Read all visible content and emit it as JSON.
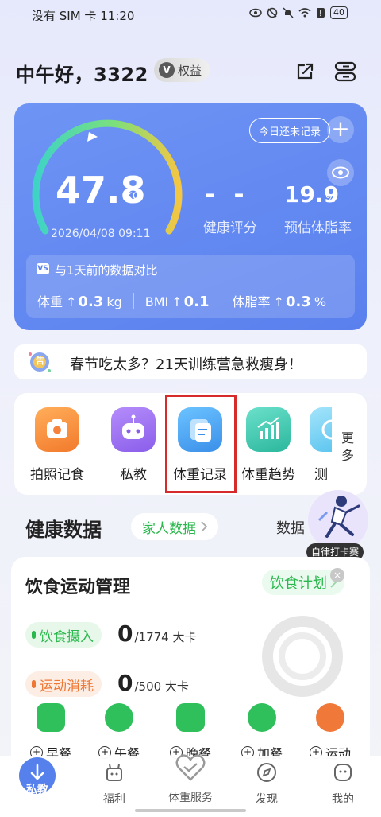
{
  "status_bar": {
    "left": "没有 SIM 卡 11:20",
    "battery": "40"
  },
  "header": {
    "greeting": "中午好，3322",
    "rights_label": "权益",
    "rights_mark": "V"
  },
  "weight_card": {
    "weight": "47.8",
    "unit": "kg",
    "date": "2026/04/08 09:11",
    "health_score": "- -",
    "health_label": "健康评分",
    "fat_value": "19.9",
    "fat_unit": "%",
    "fat_label": "预估体脂率",
    "record_button": "今日还未记录",
    "add_icon": "+",
    "compare": {
      "badge": "VS",
      "title": "与1天前的数据对比",
      "weight_label": "体重",
      "weight_arrow": "↑",
      "weight_value": "0.3",
      "weight_unit": "kg",
      "bmi_label": "BMI",
      "bmi_arrow": "↑",
      "bmi_value": "0.1",
      "fat_label": "体脂率",
      "fat_arrow": "↑",
      "fat_value": "0.3",
      "fat_unit": "%"
    }
  },
  "notice": {
    "icon_text": "告",
    "text": "春节吃太多？21天训练营急救瘦身！"
  },
  "quick_actions": [
    {
      "label": "拍照记食",
      "color": "#f5813a"
    },
    {
      "label": "私教",
      "color": "#9a6df0"
    },
    {
      "label": "体重记录",
      "color": "#4aa0f2"
    },
    {
      "label": "体重趋势",
      "color": "#3fc7b0"
    },
    {
      "label": "测",
      "color": "#66c9ef"
    }
  ],
  "more_label": "更多",
  "health_section": {
    "title": "健康数据",
    "family": "家人数据",
    "data_more": "数据"
  },
  "float_badge": {
    "label": "自律打卡赛"
  },
  "diet_card": {
    "title": "饮食运动管理",
    "plan": "饮食计划",
    "close_icon": "×",
    "intake_label": "饮食摄入",
    "intake_value": "0",
    "intake_total": "/1774 大卡",
    "burn_label": "运动消耗",
    "burn_value": "0",
    "burn_total": "/500 大卡",
    "meals": [
      {
        "label": "早餐",
        "color": "#2fbf5b"
      },
      {
        "label": "午餐",
        "color": "#2fbf5b"
      },
      {
        "label": "晚餐",
        "color": "#2fbf5b"
      },
      {
        "label": "加餐",
        "color": "#2fbf5b"
      },
      {
        "label": "运动",
        "color": "#f0793a"
      }
    ]
  },
  "bottom_nav": [
    {
      "label": "私教",
      "active": true
    },
    {
      "label": "福利"
    },
    {
      "label": "体重服务"
    },
    {
      "label": "发现"
    },
    {
      "label": "我的"
    }
  ],
  "colors": {
    "accent": "#5a80ee",
    "green": "#2ab84d",
    "orange": "#ee7733",
    "highlight": "#d72b2b"
  }
}
